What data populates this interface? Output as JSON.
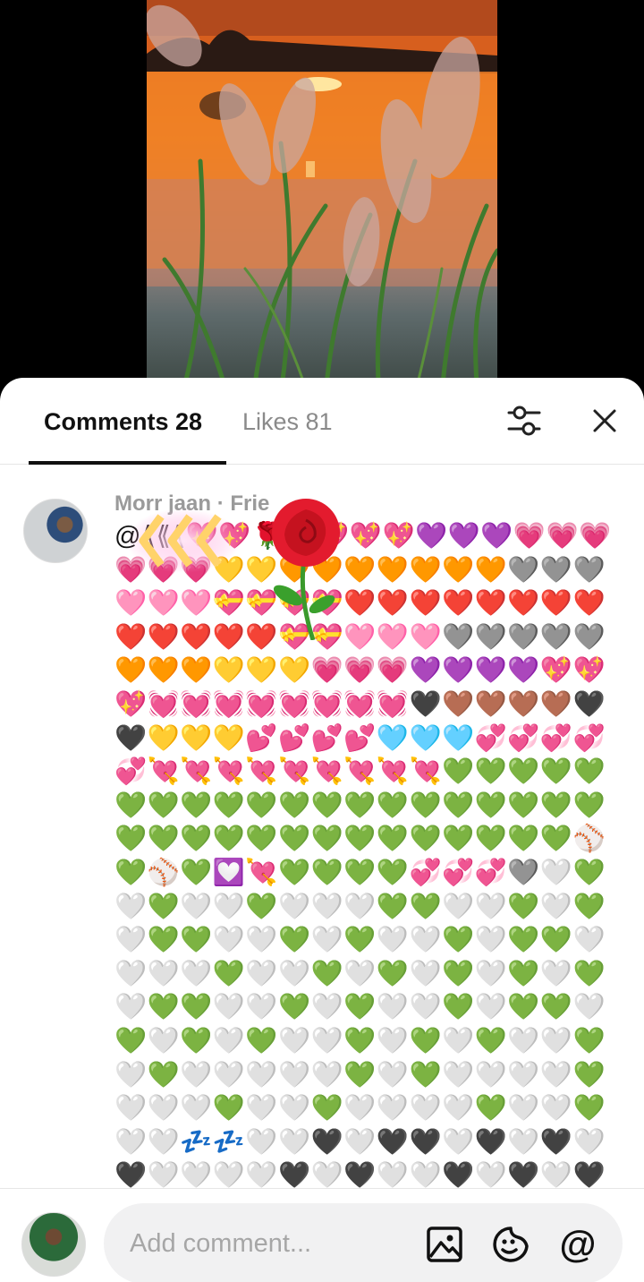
{
  "tabs": {
    "comments_label": "Comments 28",
    "likes_label": "Likes 81"
  },
  "icons": {
    "filter": "sliders-icon",
    "close": "close-icon",
    "image": "image-icon",
    "sticker": "emoji-sticker-icon",
    "mention": "at-icon"
  },
  "comment": {
    "author": "Morr jaan · Frie",
    "text": "@⟪⟪⟪💖💖🌹💖💖💖💖💜💜💜💗💗💗💗💗💗💛💛🧡🧡🧡🧡🧡🧡🧡🩶🩶🩶🩷🩷🩷💝💝💝💝❤️❤️❤️❤️❤️❤️❤️❤️❤️❤️❤️❤️❤️💝💝🩷🩷🩷🩶🩶🩶🩶🩶🧡🧡🧡💛💛💛💗💗💗💜💜💜💜💖💖💖💓💓💓💓💓💓💓💓🖤🤎🤎🤎🤎🖤🖤💛💛💛💕💕💕💕🩵🩵🩵💞💞💞💞💞💘💘💘💘💘💘💘💘💘💚💚💚💚💚💚💚💚💚💚💚💚💚💚💚💚💚💚💚💚💚💚💚💚💚💚💚💚💚💚💚💚💚💚⚾💚⚾💚💟💘💚💚💚💚💞💞💞🩶🤍💚🤍💚🤍🤍💚🤍🤍🤍💚💚🤍🤍💚🤍💚🤍💚💚🤍🤍💚🤍💚🤍🤍💚🤍💚💚🤍🤍🤍🤍💚🤍🤍💚🤍💚🤍💚🤍💚🤍💚🤍💚💚🤍🤍💚🤍💚🤍🤍💚🤍💚💚🤍💚🤍💚🤍💚🤍🤍💚🤍💚🤍💚🤍🤍💚🤍💚🤍🤍🤍🤍🤍💚🤍💚🤍🤍🤍🤍💚🤍🤍🤍💚🤍🤍💚🤍🤍🤍🤍💚🤍🤍💚🤍🤍💤💤🤍🤍🖤🤍🖤🖤🤍🖤🤍🖤🤍🖤🤍🤍🤍🤍🖤🤍🖤🤍🤍🖤🤍🖤🤍🖤🤍🤍🖤🤍🤎🤍🤍🤍🤍🖤🤍🤎🤎🤍🤍🤍🤎🤎"
  },
  "input": {
    "placeholder": "Add comment..."
  }
}
